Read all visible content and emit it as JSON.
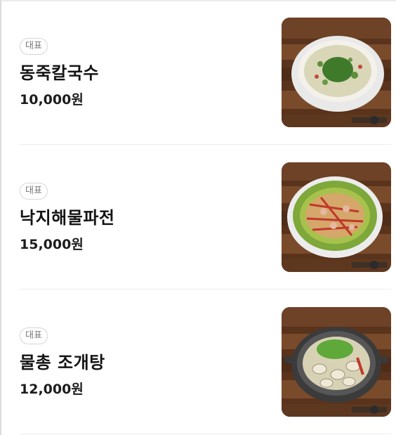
{
  "menu": {
    "items": [
      {
        "badge": "대표",
        "name": "동죽칼국수",
        "price": "10,000원",
        "image": "clam-noodle-soup-photo"
      },
      {
        "badge": "대표",
        "name": "낙지해물파전",
        "price": "15,000원",
        "image": "octopus-seafood-pancake-photo"
      },
      {
        "badge": "대표",
        "name": "물총 조개탕",
        "price": "12,000원",
        "image": "clam-soup-pot-photo"
      }
    ]
  },
  "colors": {
    "wood_dark": "#4a2a17",
    "wood_light": "#8a5a36",
    "badge_border": "#d6d6d6",
    "text": "#141414"
  }
}
